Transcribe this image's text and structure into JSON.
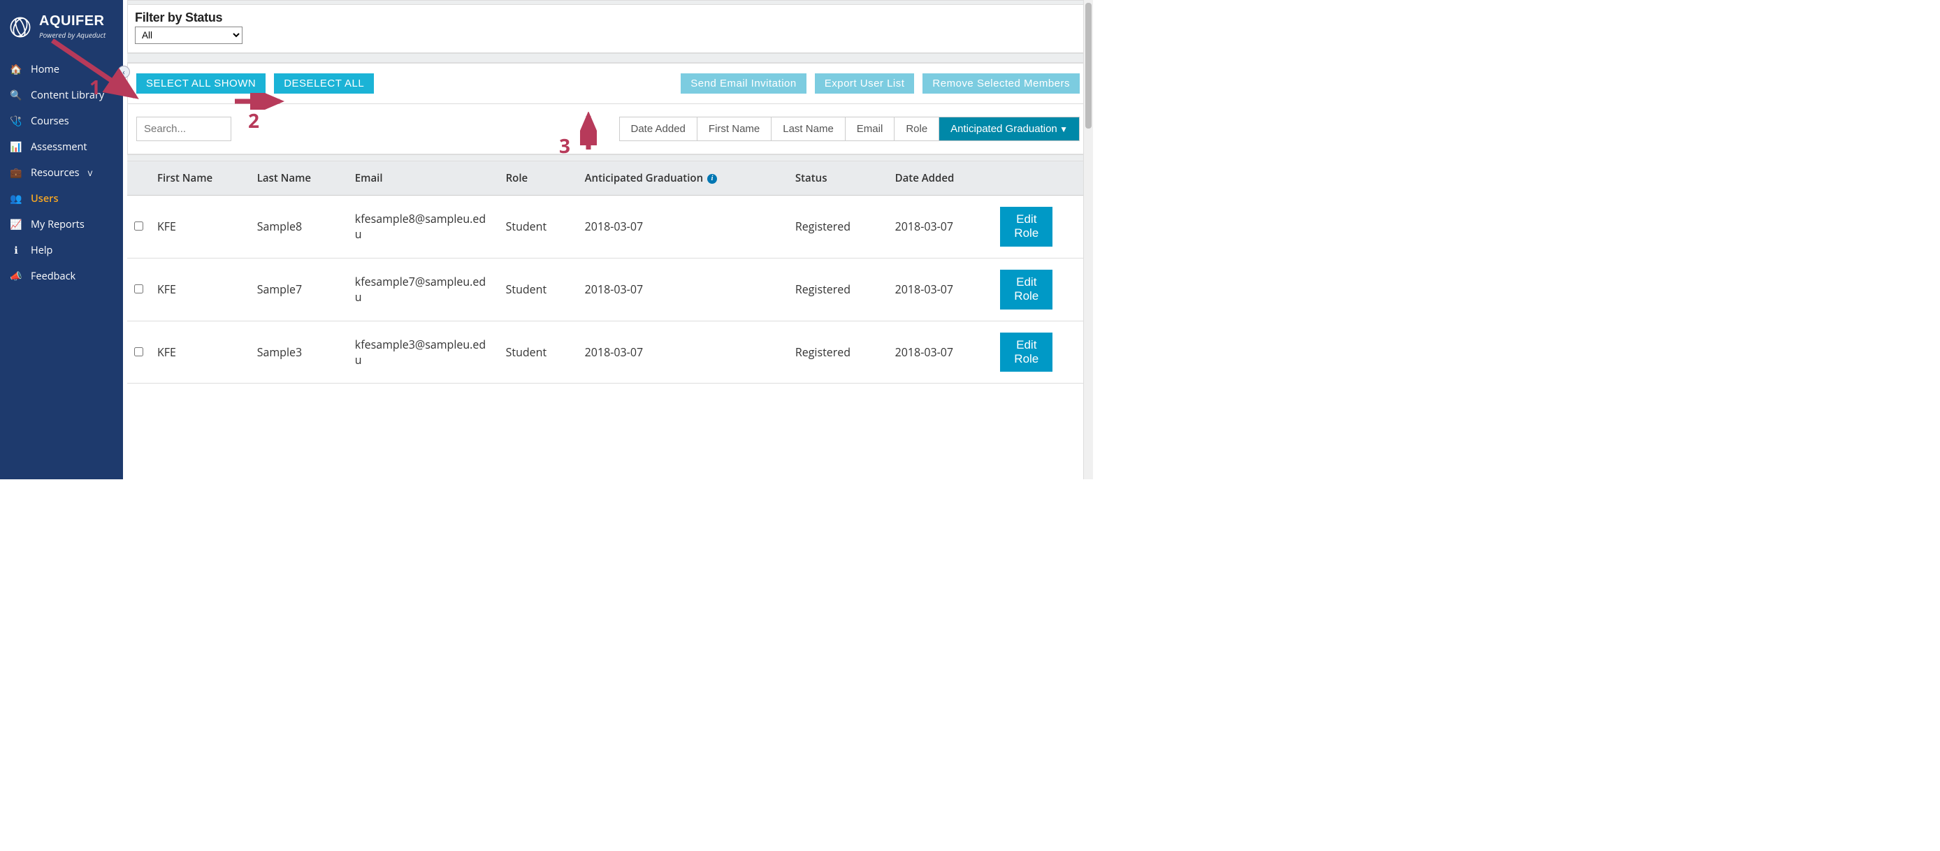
{
  "brand": {
    "title": "AQUIFER",
    "subtitle": "Powered by Aqueduct"
  },
  "nav": {
    "items": [
      {
        "label": "Home",
        "icon": "🏠"
      },
      {
        "label": "Content Library",
        "icon": "🔍"
      },
      {
        "label": "Courses",
        "icon": "🩺"
      },
      {
        "label": "Assessment",
        "icon": "📊"
      },
      {
        "label": "Resources",
        "icon": "💼",
        "chevron": "ᐯ"
      },
      {
        "label": "Users",
        "icon": "👥",
        "active": true
      },
      {
        "label": "My Reports",
        "icon": "📈"
      },
      {
        "label": "Help",
        "icon": "ℹ"
      },
      {
        "label": "Feedback",
        "icon": "📣"
      }
    ]
  },
  "filter": {
    "label": "Filter by Status",
    "value": "All"
  },
  "toolbar": {
    "select_all": "SELECT ALL SHOWN",
    "deselect_all": "DESELECT ALL",
    "send_email": "Send Email Invitation",
    "export": "Export User List",
    "remove": "Remove Selected Members"
  },
  "search": {
    "placeholder": "Search..."
  },
  "sort": {
    "buttons": [
      "Date Added",
      "First Name",
      "Last Name",
      "Email",
      "Role",
      "Anticipated Graduation"
    ],
    "active_index": 5
  },
  "table": {
    "headers": [
      "",
      "First Name",
      "Last Name",
      "Email",
      "Role",
      "Anticipated Graduation",
      "Status",
      "Date Added",
      ""
    ],
    "info_header": "i",
    "edit_label": "Edit Role",
    "rows": [
      {
        "first": "KFE",
        "last": "Sample8",
        "email": "kfesample8@sampleu.edu",
        "role": "Student",
        "grad": "2018-03-07",
        "status": "Registered",
        "added": "2018-03-07"
      },
      {
        "first": "KFE",
        "last": "Sample7",
        "email": "kfesample7@sampleu.edu",
        "role": "Student",
        "grad": "2018-03-07",
        "status": "Registered",
        "added": "2018-03-07"
      },
      {
        "first": "KFE",
        "last": "Sample3",
        "email": "kfesample3@sampleu.edu",
        "role": "Student",
        "grad": "2018-03-07",
        "status": "Registered",
        "added": "2018-03-07"
      }
    ]
  },
  "annotations": {
    "one": "1",
    "two": "2",
    "three": "3"
  }
}
